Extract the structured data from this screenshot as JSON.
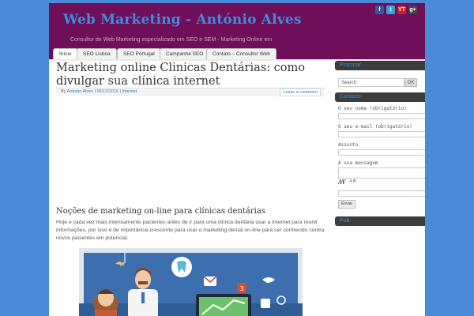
{
  "site": {
    "title": "Web Marketing - António Alves",
    "tagline": "Consultor de Web Marketing especializado em SEO e SEM - Marketing Online em",
    "social": [
      {
        "icon": "facebook-icon",
        "glyph": "f"
      },
      {
        "icon": "twitter-icon",
        "glyph": "t"
      },
      {
        "icon": "youtube-icon",
        "glyph": "YT"
      },
      {
        "icon": "google-plus-icon",
        "glyph": "g+"
      }
    ]
  },
  "nav": {
    "items": [
      "Início",
      "SEO Lisboa",
      "SEO Portugal",
      "Campanha SEO",
      "Contato – Consultor Web"
    ]
  },
  "post": {
    "title": "Marketing online Clinicas Dentárias: como divulgar sua clínica internet",
    "meta_by": "By",
    "meta_author": "Antonio Alves",
    "meta_sep1": "|",
    "meta_date": "06/12/2016",
    "meta_sep2": "|",
    "meta_category": "Internet",
    "leave_comment": "Leave a comment",
    "section_heading": "Noções de marketing on-line para clínicas dentárias",
    "body": "Hoje e cada vez mais intensamente pacientes antes de ir para uma clínica dentária usar a Internet para reunir informações, por isso é de importância crescente para usar o marketing dental on-line para ser conhecido contra novos pacientes em potencial."
  },
  "sidebar": {
    "search_title": "Procurar",
    "search_placeholder": "Search",
    "search_button": "OK",
    "contact_title": "Contacto",
    "name_label": "O seu nome (obrigatório)",
    "email_label": "O seu e-mail (obrigatório)",
    "subject_label": "Assunto",
    "message_label": "A sua mensagem",
    "captcha": "ꟿ ᴬᴮ",
    "send_button": "Enviar",
    "pub_title": "Pub"
  },
  "colors": {
    "background": "#4a8ad6",
    "header": "#6f0f5a",
    "title_blue": "#3d8ee0",
    "link": "#2a7ac2",
    "widget_bar": "#3c3c3c"
  }
}
